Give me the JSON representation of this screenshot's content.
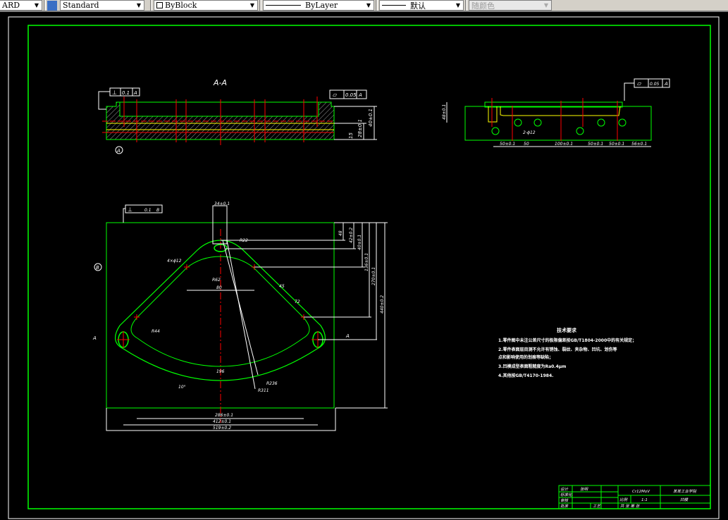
{
  "toolbar": {
    "textstyle_partial": "ARD",
    "dimstyle": "Standard",
    "color": "ByBlock",
    "linetype": "ByLayer",
    "lineweight": "默认",
    "plotstyle": "随颜色"
  },
  "drawing": {
    "section_title": "A-A",
    "fcf_top_left": {
      "symbol": "⊥",
      "tol": "0.1",
      "datum": "A"
    },
    "fcf_top_right": {
      "symbol": "▱",
      "tol": "0.05",
      "datum": "A"
    },
    "fcf_side": {
      "symbol": "▱",
      "tol": "0.05",
      "datum": "A"
    },
    "fcf_plan": {
      "symbol": "⊥",
      "tol": "0.1",
      "datum": "B"
    },
    "datum_a": "A",
    "datum_b": "B",
    "section_mark_left": "A",
    "section_mark_right": "A",
    "dims_section": [
      "40±0.1",
      "28±0.1",
      "15"
    ],
    "dims_side": [
      "48±0.1",
      "50±0.1",
      "50",
      "100±0.1",
      "50±0.1",
      "50±0.1",
      "56±0.1",
      "2-ϕ12"
    ],
    "dims_plan": {
      "top_width": "34±0.1",
      "r_top": "R22",
      "hole": "4×ϕ12",
      "r62": "R62",
      "w80": "80",
      "r44": "R44",
      "d1": "45",
      "d2": "72",
      "dim_bottom_center": "196",
      "angle": "10°",
      "r_b1": "R236",
      "r_b2": "R311",
      "w_inner": "286±0.1",
      "w_mid": "412±0.1",
      "w_outer": "519±0.2",
      "v1": "48",
      "v2": "42±0.2",
      "v3": "40±0.1",
      "v4": "136±0.1",
      "v5": "270±0.1",
      "v6": "440±0.2"
    }
  },
  "tech_requirements": {
    "title": "技术要求",
    "lines": [
      "1.零件图中未注公差尺寸的极限偏差按GB/T1804-2000中的有关规定；",
      "2.零件表面层目测不允许有锈蚀、裂纹、夹杂物、凹坑、划伤等",
      "点和影响使用的划痕等缺陷；",
      "3.凹模成型表面粗糙度为Ra0.4μm",
      "4.其他按GB/T4170-1984."
    ]
  },
  "title_block": {
    "design": "设计",
    "designer": "张明",
    "standard": "标准化",
    "review": "审核",
    "approve": "批准",
    "process": "工艺",
    "material": "Cr12MoV",
    "school": "某某工业学院",
    "scale_label": "比例",
    "scale": "1:1",
    "part": "凹模",
    "sheet_info": "共 张 第 张"
  },
  "colors": {
    "outline": "#00ff00",
    "centerline": "#ff0000",
    "hidden": "#ffff00",
    "dimension": "#ffffff"
  }
}
